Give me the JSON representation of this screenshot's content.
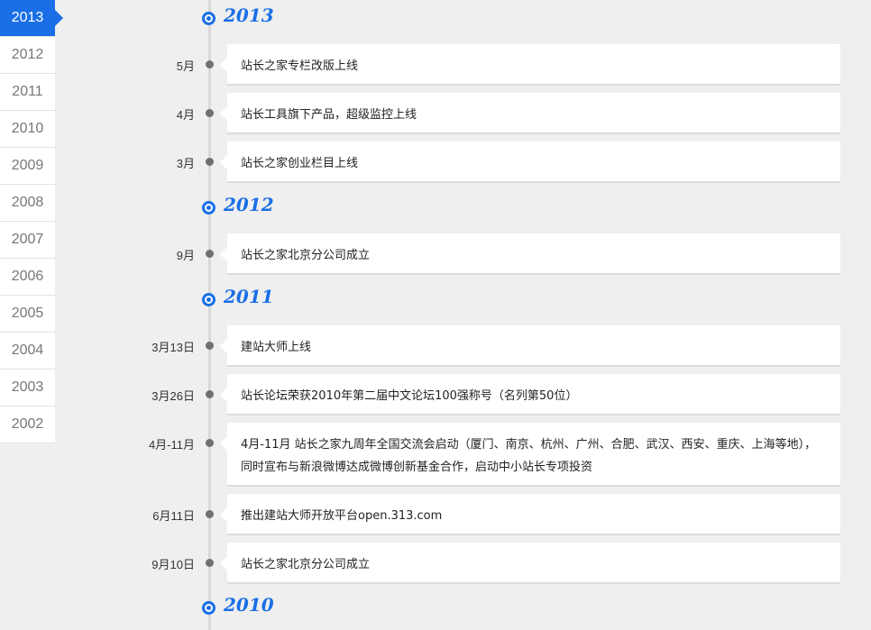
{
  "years_nav": [
    {
      "label": "2013",
      "active": true
    },
    {
      "label": "2012"
    },
    {
      "label": "2011"
    },
    {
      "label": "2010"
    },
    {
      "label": "2009"
    },
    {
      "label": "2008"
    },
    {
      "label": "2007"
    },
    {
      "label": "2006"
    },
    {
      "label": "2005"
    },
    {
      "label": "2004"
    },
    {
      "label": "2003"
    },
    {
      "label": "2002"
    }
  ],
  "timeline": {
    "y2013": {
      "title": "2013",
      "events": [
        {
          "date": "5月",
          "text": "站长之家专栏改版上线"
        },
        {
          "date": "4月",
          "text": "站长工具旗下产品，超级监控上线"
        },
        {
          "date": "3月",
          "text": "站长之家创业栏目上线"
        }
      ]
    },
    "y2012": {
      "title": "2012",
      "events": [
        {
          "date": "9月",
          "text": "站长之家北京分公司成立"
        }
      ]
    },
    "y2011": {
      "title": "2011",
      "events": [
        {
          "date": "3月13日",
          "text": "建站大师上线"
        },
        {
          "date": "3月26日",
          "text": "站长论坛荣获2010年第二届中文论坛100强称号（名列第50位）"
        },
        {
          "date": "4月-11月",
          "text": "4月-11月 站长之家九周年全国交流会启动（厦门、南京、杭州、广州、合肥、武汉、西安、重庆、上海等地），同时宣布与新浪微博达成微博创新基金合作，启动中小站长专项投资"
        },
        {
          "date": "6月11日",
          "text": "推出建站大师开放平台open.313.com"
        },
        {
          "date": "9月10日",
          "text": "站长之家北京分公司成立"
        }
      ]
    },
    "y2010": {
      "title": "2010"
    }
  }
}
